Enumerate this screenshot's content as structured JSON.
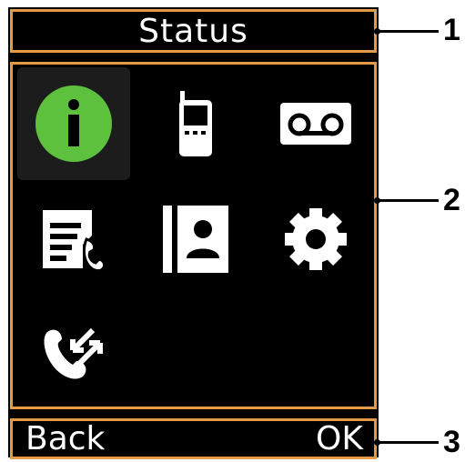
{
  "screen": {
    "title": "Status",
    "softkeys": {
      "left": "Back",
      "right": "OK"
    }
  },
  "menu": {
    "selected_index": 0,
    "items": [
      {
        "icon": "info-icon"
      },
      {
        "icon": "handset-icon"
      },
      {
        "icon": "voicemail-icon"
      },
      {
        "icon": "call-log-icon"
      },
      {
        "icon": "directory-icon"
      },
      {
        "icon": "gear-icon"
      },
      {
        "icon": "intercom-icon"
      }
    ]
  },
  "callouts": [
    "1",
    "2",
    "3"
  ],
  "colors": {
    "highlight_border": "#e39b45",
    "selected_icon": "#5ec13e",
    "screen_background": "#000000"
  }
}
